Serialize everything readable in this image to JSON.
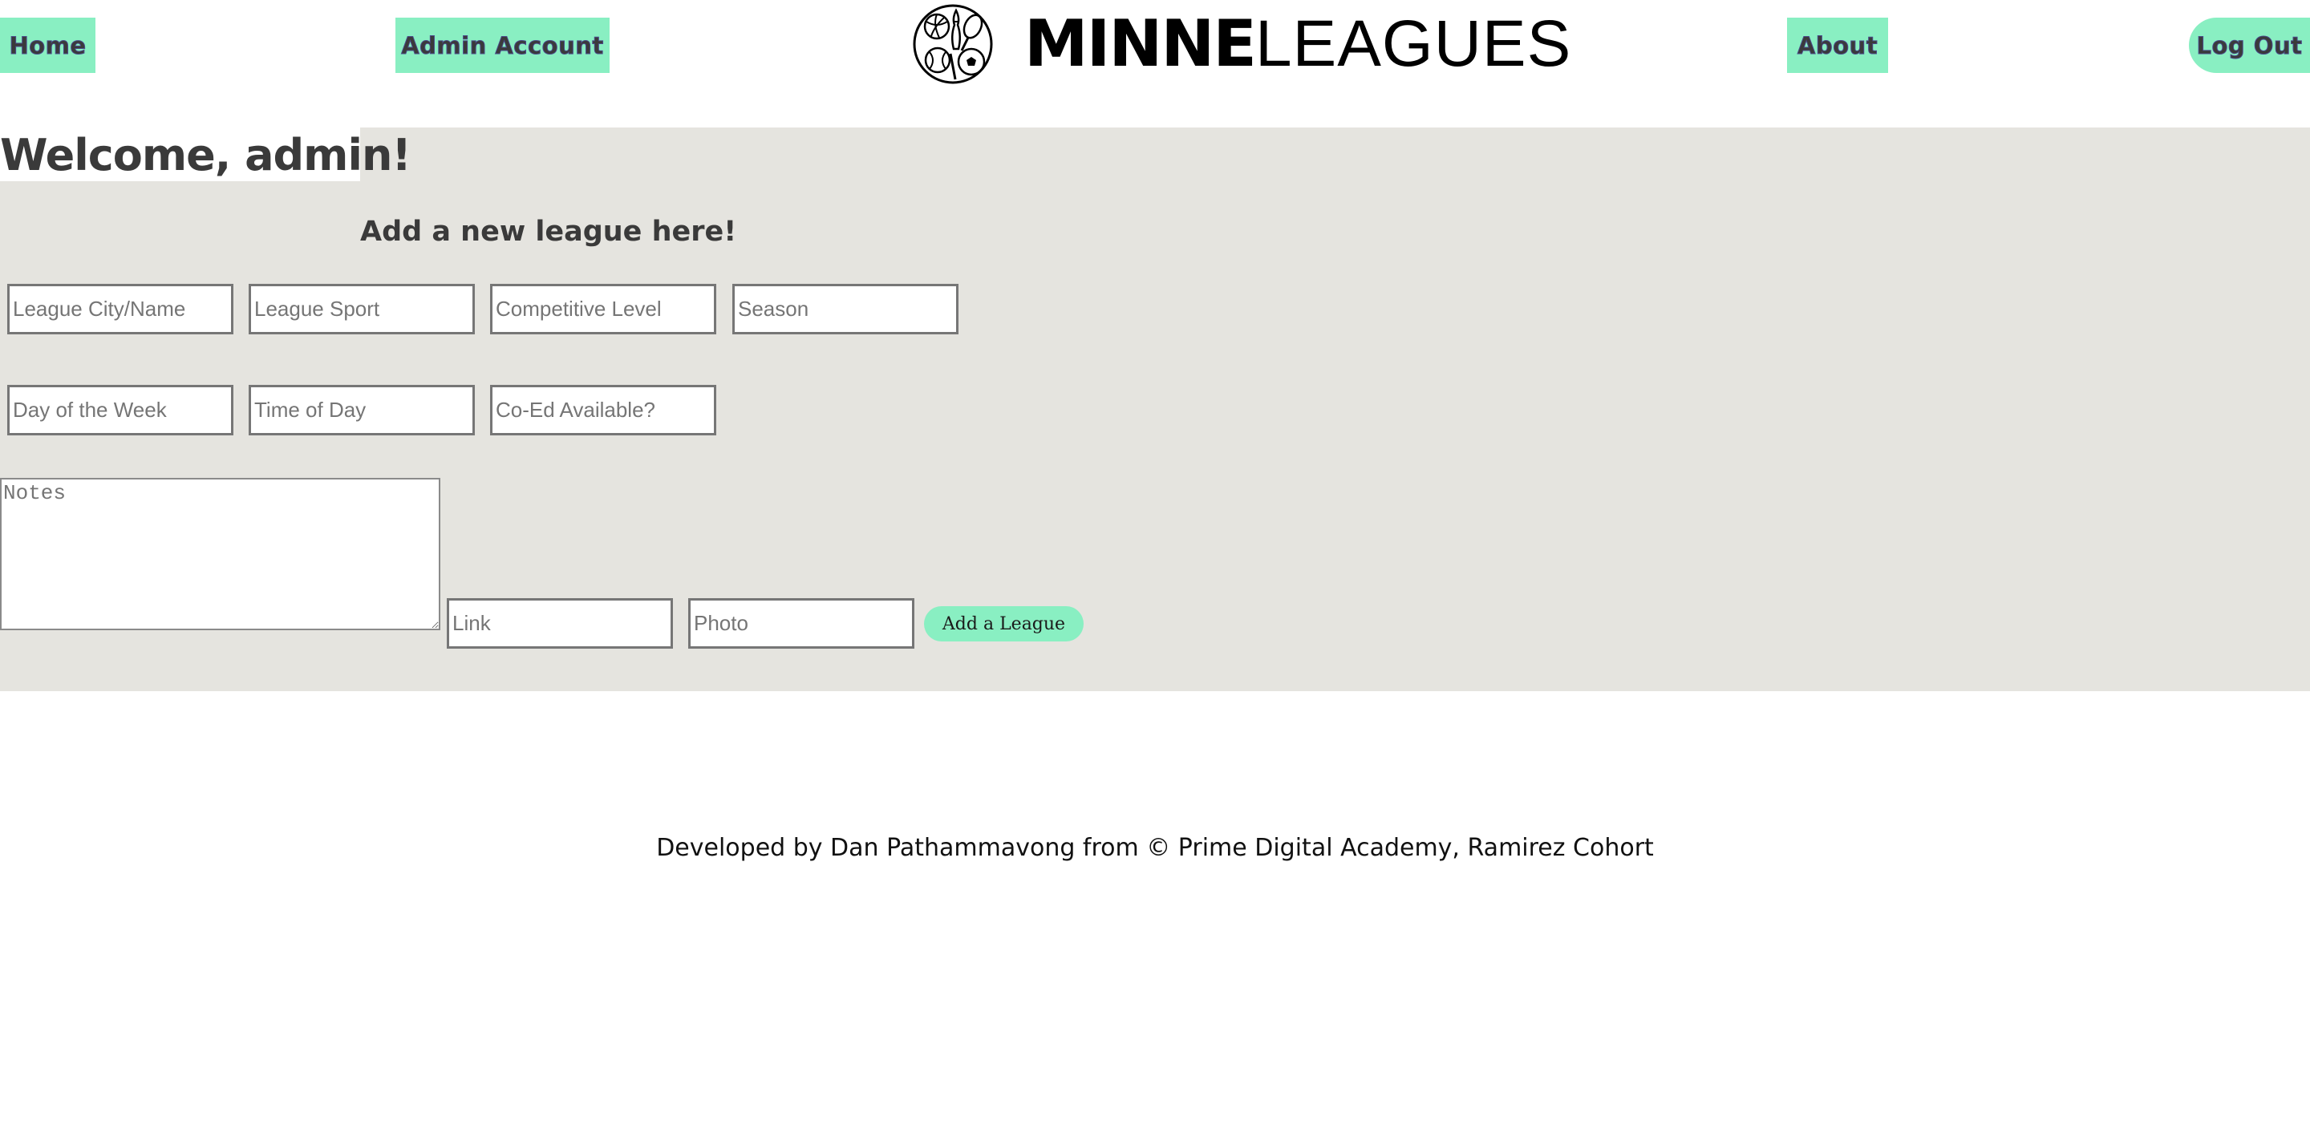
{
  "nav": {
    "home_label": "Home",
    "admin_account_label": "Admin Account",
    "about_label": "About",
    "logout_label": "Log Out",
    "accent_color": "#89efc2"
  },
  "logo": {
    "brand_bold": "MINNE",
    "brand_light": "LEAGUES",
    "icon": "sports-balls-icon"
  },
  "main": {
    "welcome": "Welcome, admin!",
    "form_title": "Add a new league here!",
    "panel_color": "#e5e4df",
    "fields": {
      "league_city_name": "League City/Name",
      "league_sport": "League Sport",
      "competitive_level": "Competitive Level",
      "season": "Season",
      "day_of_week": "Day of the Week",
      "time_of_day": "Time of Day",
      "coed": "Co-Ed Available?",
      "notes": "Notes",
      "link": "Link",
      "photo": "Photo"
    },
    "add_button_label": "Add a League"
  },
  "footer": {
    "text": "Developed by Dan Pathammavong from © Prime Digital Academy, Ramirez Cohort"
  }
}
